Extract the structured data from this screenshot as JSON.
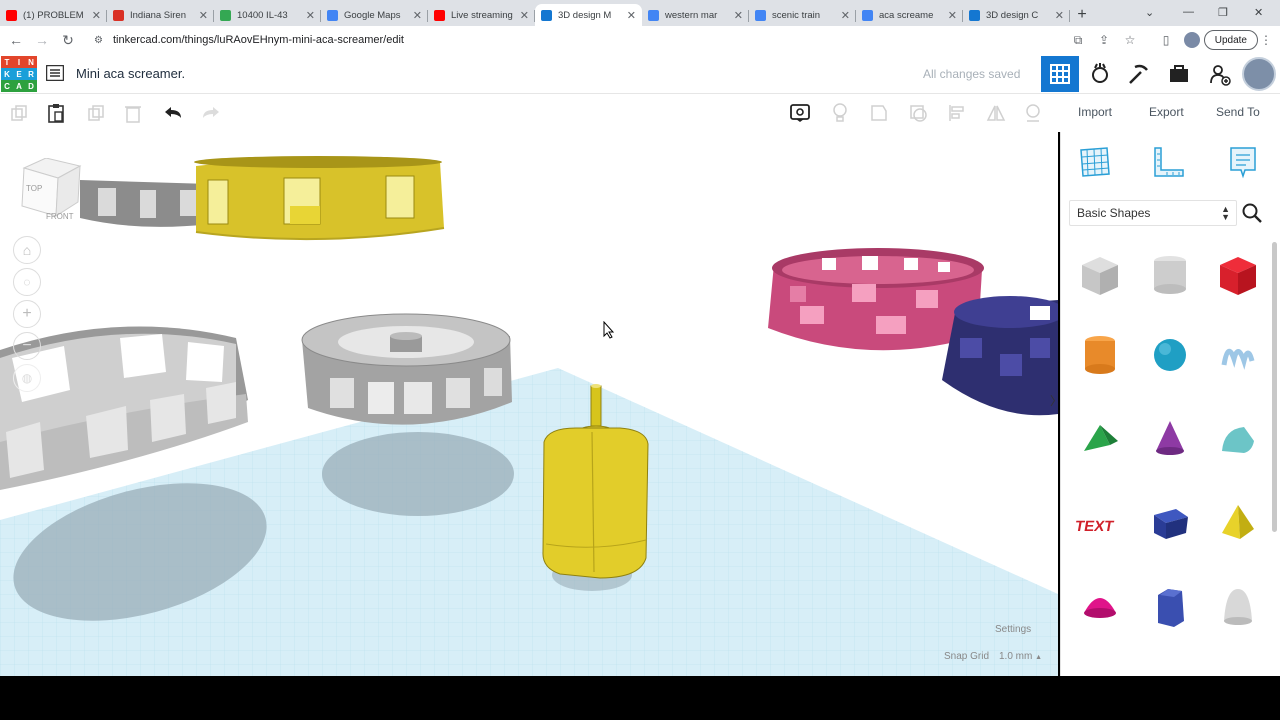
{
  "browser": {
    "tabs": [
      {
        "title": "(1) PROBLEM",
        "favicon_color": "#ff0000"
      },
      {
        "title": "Indiana Siren",
        "favicon_color": "#d93025"
      },
      {
        "title": "10400 IL-43",
        "favicon_color": "#34a853"
      },
      {
        "title": "Google Maps",
        "favicon_color": "#4285f4"
      },
      {
        "title": "Live streaming",
        "favicon_color": "#ff0000"
      },
      {
        "title": "3D design M",
        "favicon_color": "#1477d1",
        "active": true
      },
      {
        "title": "western mar",
        "favicon_color": "#4285f4"
      },
      {
        "title": "scenic train",
        "favicon_color": "#4285f4"
      },
      {
        "title": "aca screame",
        "favicon_color": "#4285f4"
      },
      {
        "title": "3D design C",
        "favicon_color": "#1477d1"
      }
    ],
    "new_tab": "+",
    "url": "tinkercad.com/things/luRAovEHnym-mini-aca-screamer/edit",
    "update_label": "Update"
  },
  "app": {
    "logo_letters": [
      "T",
      "I",
      "N",
      "K",
      "E",
      "R",
      "C",
      "A",
      "D"
    ],
    "design_title": "Mini aca screamer.",
    "save_status": "All changes saved"
  },
  "toolbar": {
    "import_label": "Import",
    "export_label": "Export",
    "send_to_label": "Send To"
  },
  "viewport": {
    "view_cube_top": "TOP",
    "view_cube_front": "FRONT",
    "settings_label": "Settings",
    "snap_grid_label": "Snap Grid",
    "snap_grid_value": "1.0 mm"
  },
  "panel": {
    "shape_library": "Basic Shapes",
    "shapes": [
      "box",
      "cylinder-hole",
      "box-red",
      "cylinder",
      "sphere",
      "scribble",
      "roof",
      "cone",
      "round-roof",
      "text",
      "box-blue",
      "pyramid",
      "half-sphere",
      "polygon",
      "paraboloid"
    ]
  },
  "colors": {
    "accent": "#1477d1",
    "grid": "#c7e6f2"
  }
}
